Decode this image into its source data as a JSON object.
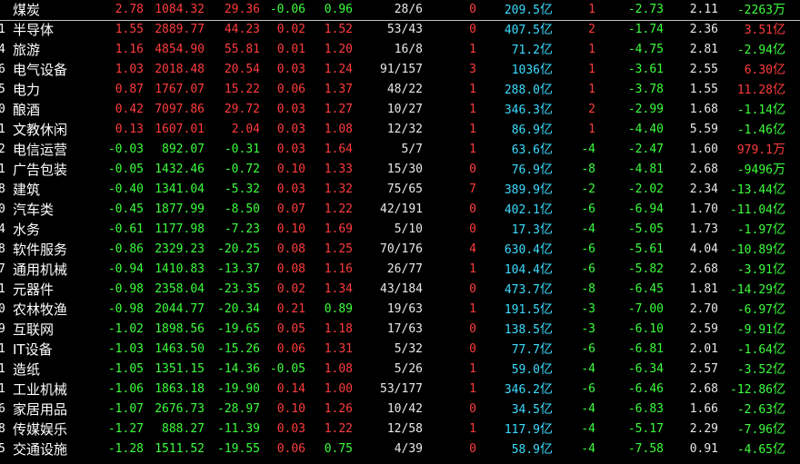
{
  "colors": {
    "background": "#000000",
    "up": "#ff3c3c",
    "down": "#3cff3c",
    "flat": "#e8e8e8",
    "amount": "#3cdcff"
  },
  "rows": [
    {
      "idx": "",
      "name": "煤炭",
      "pct": "2.78",
      "price": "1084.32",
      "chg": "29.36",
      "speed": "-0.06",
      "volratio": "0.96",
      "updown": "28/6",
      "limitup": "0",
      "amount": "209.5",
      "amount_unit": "亿",
      "lead": "1",
      "lead_pct": "-2.73",
      "turnover": "2.11",
      "net": "-2263",
      "net_unit": "万"
    },
    {
      "idx": "1",
      "name": "半导体",
      "pct": "1.55",
      "price": "2889.77",
      "chg": "44.23",
      "speed": "0.02",
      "volratio": "1.52",
      "updown": "53/43",
      "limitup": "0",
      "amount": "407.5",
      "amount_unit": "亿",
      "lead": "2",
      "lead_pct": "-1.74",
      "turnover": "2.36",
      "net": "3.51",
      "net_unit": "亿"
    },
    {
      "idx": "4",
      "name": "旅游",
      "pct": "1.16",
      "price": "4854.90",
      "chg": "55.81",
      "speed": "0.01",
      "volratio": "1.20",
      "updown": "16/8",
      "limitup": "1",
      "amount": "71.2",
      "amount_unit": "亿",
      "lead": "1",
      "lead_pct": "-4.75",
      "turnover": "2.81",
      "net": "-2.94",
      "net_unit": "亿"
    },
    {
      "idx": "6",
      "name": "电气设备",
      "pct": "1.03",
      "price": "2018.48",
      "chg": "20.54",
      "speed": "0.03",
      "volratio": "1.24",
      "updown": "91/157",
      "limitup": "3",
      "amount": "1036",
      "amount_unit": "亿",
      "lead": "1",
      "lead_pct": "-3.61",
      "turnover": "2.55",
      "net": "6.30",
      "net_unit": "亿"
    },
    {
      "idx": "5",
      "name": "电力",
      "pct": "0.87",
      "price": "1767.07",
      "chg": "15.22",
      "speed": "0.06",
      "volratio": "1.37",
      "updown": "48/22",
      "limitup": "1",
      "amount": "288.0",
      "amount_unit": "亿",
      "lead": "1",
      "lead_pct": "-3.78",
      "turnover": "1.55",
      "net": "11.28",
      "net_unit": "亿"
    },
    {
      "idx": "0",
      "name": "酿酒",
      "pct": "0.42",
      "price": "7097.86",
      "chg": "29.72",
      "speed": "0.03",
      "volratio": "1.27",
      "updown": "10/27",
      "limitup": "1",
      "amount": "346.3",
      "amount_unit": "亿",
      "lead": "2",
      "lead_pct": "-2.99",
      "turnover": "1.68",
      "net": "-1.14",
      "net_unit": "亿"
    },
    {
      "idx": "1",
      "name": "文教休闲",
      "pct": "0.13",
      "price": "1607.01",
      "chg": "2.04",
      "speed": "0.03",
      "volratio": "1.08",
      "updown": "12/32",
      "limitup": "1",
      "amount": "86.9",
      "amount_unit": "亿",
      "lead": "1",
      "lead_pct": "-4.40",
      "turnover": "5.59",
      "net": "-1.46",
      "net_unit": "亿"
    },
    {
      "idx": "2",
      "name": "电信运营",
      "pct": "-0.03",
      "price": "892.07",
      "chg": "-0.31",
      "speed": "0.03",
      "volratio": "1.64",
      "updown": "5/7",
      "limitup": "1",
      "amount": "63.6",
      "amount_unit": "亿",
      "lead": "-4",
      "lead_pct": "-2.47",
      "turnover": "1.60",
      "net": "979.1",
      "net_unit": "万"
    },
    {
      "idx": "1",
      "name": "广告包装",
      "pct": "-0.05",
      "price": "1432.46",
      "chg": "-0.72",
      "speed": "0.10",
      "volratio": "1.33",
      "updown": "15/30",
      "limitup": "0",
      "amount": "76.9",
      "amount_unit": "亿",
      "lead": "-8",
      "lead_pct": "-4.81",
      "turnover": "2.68",
      "net": "-9496",
      "net_unit": "万"
    },
    {
      "idx": "8",
      "name": "建筑",
      "pct": "-0.40",
      "price": "1341.04",
      "chg": "-5.32",
      "speed": "0.03",
      "volratio": "1.32",
      "updown": "75/65",
      "limitup": "7",
      "amount": "389.9",
      "amount_unit": "亿",
      "lead": "-2",
      "lead_pct": "-2.02",
      "turnover": "2.34",
      "net": "-13.44",
      "net_unit": "亿"
    },
    {
      "idx": "0",
      "name": "汽车类",
      "pct": "-0.45",
      "price": "1877.99",
      "chg": "-8.50",
      "speed": "0.07",
      "volratio": "1.22",
      "updown": "42/191",
      "limitup": "0",
      "amount": "402.1",
      "amount_unit": "亿",
      "lead": "-6",
      "lead_pct": "-6.94",
      "turnover": "1.70",
      "net": "-11.04",
      "net_unit": "亿"
    },
    {
      "idx": "4",
      "name": "水务",
      "pct": "-0.61",
      "price": "1177.98",
      "chg": "-7.23",
      "speed": "0.10",
      "volratio": "1.69",
      "updown": "5/10",
      "limitup": "0",
      "amount": "17.3",
      "amount_unit": "亿",
      "lead": "-4",
      "lead_pct": "-5.05",
      "turnover": "1.73",
      "net": "-1.97",
      "net_unit": "亿"
    },
    {
      "idx": "8",
      "name": "软件服务",
      "pct": "-0.86",
      "price": "2329.23",
      "chg": "-20.25",
      "speed": "0.08",
      "volratio": "1.25",
      "updown": "70/176",
      "limitup": "4",
      "amount": "630.4",
      "amount_unit": "亿",
      "lead": "-6",
      "lead_pct": "-5.61",
      "turnover": "4.04",
      "net": "-10.89",
      "net_unit": "亿"
    },
    {
      "idx": "7",
      "name": "通用机械",
      "pct": "-0.94",
      "price": "1410.83",
      "chg": "-13.37",
      "speed": "0.08",
      "volratio": "1.16",
      "updown": "26/77",
      "limitup": "1",
      "amount": "104.4",
      "amount_unit": "亿",
      "lead": "-6",
      "lead_pct": "-5.82",
      "turnover": "2.68",
      "net": "-3.91",
      "net_unit": "亿"
    },
    {
      "idx": "1",
      "name": "元器件",
      "pct": "-0.98",
      "price": "2358.04",
      "chg": "-23.35",
      "speed": "0.02",
      "volratio": "1.34",
      "updown": "43/184",
      "limitup": "0",
      "amount": "473.7",
      "amount_unit": "亿",
      "lead": "-8",
      "lead_pct": "-6.45",
      "turnover": "1.81",
      "net": "-14.29",
      "net_unit": "亿"
    },
    {
      "idx": "0",
      "name": "农林牧渔",
      "pct": "-0.98",
      "price": "2044.77",
      "chg": "-20.34",
      "speed": "0.21",
      "volratio": "0.89",
      "updown": "19/63",
      "limitup": "1",
      "amount": "191.5",
      "amount_unit": "亿",
      "lead": "-3",
      "lead_pct": "-7.00",
      "turnover": "2.70",
      "net": "-6.97",
      "net_unit": "亿"
    },
    {
      "idx": "9",
      "name": "互联网",
      "pct": "-1.02",
      "price": "1898.56",
      "chg": "-19.65",
      "speed": "0.05",
      "volratio": "1.18",
      "updown": "17/63",
      "limitup": "0",
      "amount": "138.5",
      "amount_unit": "亿",
      "lead": "-3",
      "lead_pct": "-6.10",
      "turnover": "2.59",
      "net": "-9.91",
      "net_unit": "亿"
    },
    {
      "idx": "1",
      "name": "IT设备",
      "pct": "-1.03",
      "price": "1463.50",
      "chg": "-15.26",
      "speed": "0.06",
      "volratio": "1.31",
      "updown": "5/32",
      "limitup": "0",
      "amount": "77.7",
      "amount_unit": "亿",
      "lead": "-6",
      "lead_pct": "-6.81",
      "turnover": "2.01",
      "net": "-1.64",
      "net_unit": "亿"
    },
    {
      "idx": "1",
      "name": "造纸",
      "pct": "-1.05",
      "price": "1351.15",
      "chg": "-14.36",
      "speed": "-0.05",
      "volratio": "1.08",
      "updown": "5/26",
      "limitup": "1",
      "amount": "59.0",
      "amount_unit": "亿",
      "lead": "-4",
      "lead_pct": "-6.34",
      "turnover": "2.57",
      "net": "-3.52",
      "net_unit": "亿"
    },
    {
      "idx": "1",
      "name": "工业机械",
      "pct": "-1.06",
      "price": "1863.18",
      "chg": "-19.90",
      "speed": "0.14",
      "volratio": "1.00",
      "updown": "53/177",
      "limitup": "1",
      "amount": "346.2",
      "amount_unit": "亿",
      "lead": "-6",
      "lead_pct": "-6.46",
      "turnover": "2.68",
      "net": "-12.86",
      "net_unit": "亿"
    },
    {
      "idx": "6",
      "name": "家居用品",
      "pct": "-1.07",
      "price": "2676.73",
      "chg": "-28.97",
      "speed": "0.10",
      "volratio": "1.26",
      "updown": "10/42",
      "limitup": "0",
      "amount": "34.5",
      "amount_unit": "亿",
      "lead": "-4",
      "lead_pct": "-6.83",
      "turnover": "1.66",
      "net": "-2.63",
      "net_unit": "亿"
    },
    {
      "idx": "8",
      "name": "传媒娱乐",
      "pct": "-1.27",
      "price": "888.27",
      "chg": "-11.39",
      "speed": "0.03",
      "volratio": "1.22",
      "updown": "12/58",
      "limitup": "1",
      "amount": "117.9",
      "amount_unit": "亿",
      "lead": "-4",
      "lead_pct": "-5.17",
      "turnover": "2.29",
      "net": "-7.96",
      "net_unit": "亿"
    },
    {
      "idx": "5",
      "name": "交通设施",
      "pct": "-1.28",
      "price": "1511.52",
      "chg": "-19.55",
      "speed": "0.06",
      "volratio": "0.75",
      "updown": "4/39",
      "limitup": "0",
      "amount": "58.9",
      "amount_unit": "亿",
      "lead": "-4",
      "lead_pct": "-7.58",
      "turnover": "0.91",
      "net": "-4.65",
      "net_unit": "亿"
    }
  ]
}
